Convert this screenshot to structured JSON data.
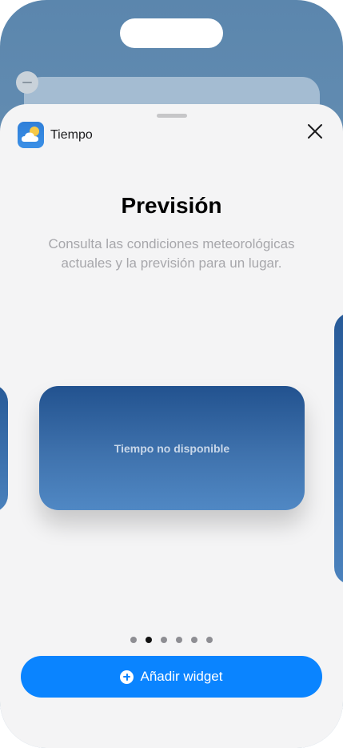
{
  "app": {
    "name": "Tiempo",
    "icon": "weather-app-icon"
  },
  "sheet": {
    "title": "Previsión",
    "description": "Consulta las condiciones meteorológicas actuales y la previsión para un lugar.",
    "close_icon": "close-icon"
  },
  "widget": {
    "status_text": "Tiempo no disponible"
  },
  "pagination": {
    "total": 6,
    "current": 2
  },
  "actions": {
    "add_widget_label": "Añadir widget",
    "add_icon": "plus-circle-icon"
  },
  "colors": {
    "accent": "#0a84ff",
    "widget_top": "#22528f",
    "widget_bottom": "#5088c4"
  }
}
